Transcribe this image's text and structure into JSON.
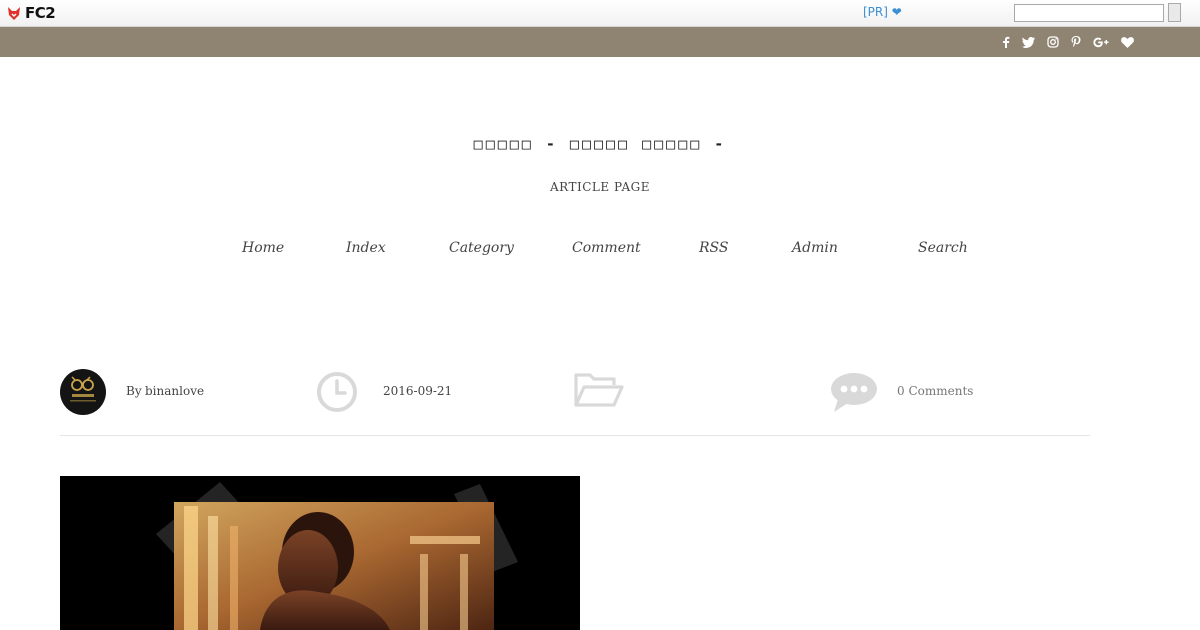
{
  "fc2bar": {
    "logo_text": "FC2",
    "pr_text": "[PR] ❤",
    "search_value": ""
  },
  "social": {
    "icons": [
      "facebook-icon",
      "twitter-icon",
      "instagram-icon",
      "pinterest-icon",
      "google-plus-icon",
      "heart-icon"
    ],
    "glyphs": [
      "f",
      "🐦",
      "◎",
      "P",
      "G+",
      "♥"
    ],
    "bar_color": "#8f8471"
  },
  "header": {
    "title": "□□□□□ - □□□□□ □□□□□ -",
    "page_type": "ARTICLE PAGE"
  },
  "nav": {
    "items": [
      "Home",
      "Index",
      "Category",
      "Comment",
      "RSS",
      "Admin",
      "Search"
    ]
  },
  "meta": {
    "by_label": "By",
    "author": "binanlove",
    "date": "2016-09-21",
    "comments": "0 Comments"
  },
  "colors": {
    "accent": "#8f8471",
    "icon_gray": "#d9d9d9",
    "link_blue": "#3b8fd4"
  }
}
